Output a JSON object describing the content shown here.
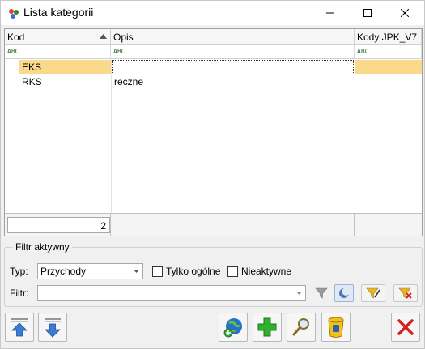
{
  "window": {
    "title": "Lista kategorii"
  },
  "grid": {
    "columns": [
      "Kod",
      "Opis",
      "Kody JPK_V7"
    ],
    "filter_glyph": "ABC",
    "rows": [
      {
        "kod": "EKS",
        "opis": "",
        "jpk": ""
      },
      {
        "kod": "RKS",
        "opis": "reczne",
        "jpk": ""
      }
    ],
    "count": "2"
  },
  "filters": {
    "group_title": "Filtr aktywny",
    "typ_label": "Typ:",
    "typ_value": "Przychody",
    "tylko_ogolne_label": "Tylko ogólne",
    "nieaktywne_label": "Nieaktywne",
    "filtr_label": "Filtr:",
    "filtr_value": ""
  },
  "colors": {
    "selection": "#fbd98a",
    "accent_green": "#2a9d2a",
    "delete_red": "#d42020"
  }
}
